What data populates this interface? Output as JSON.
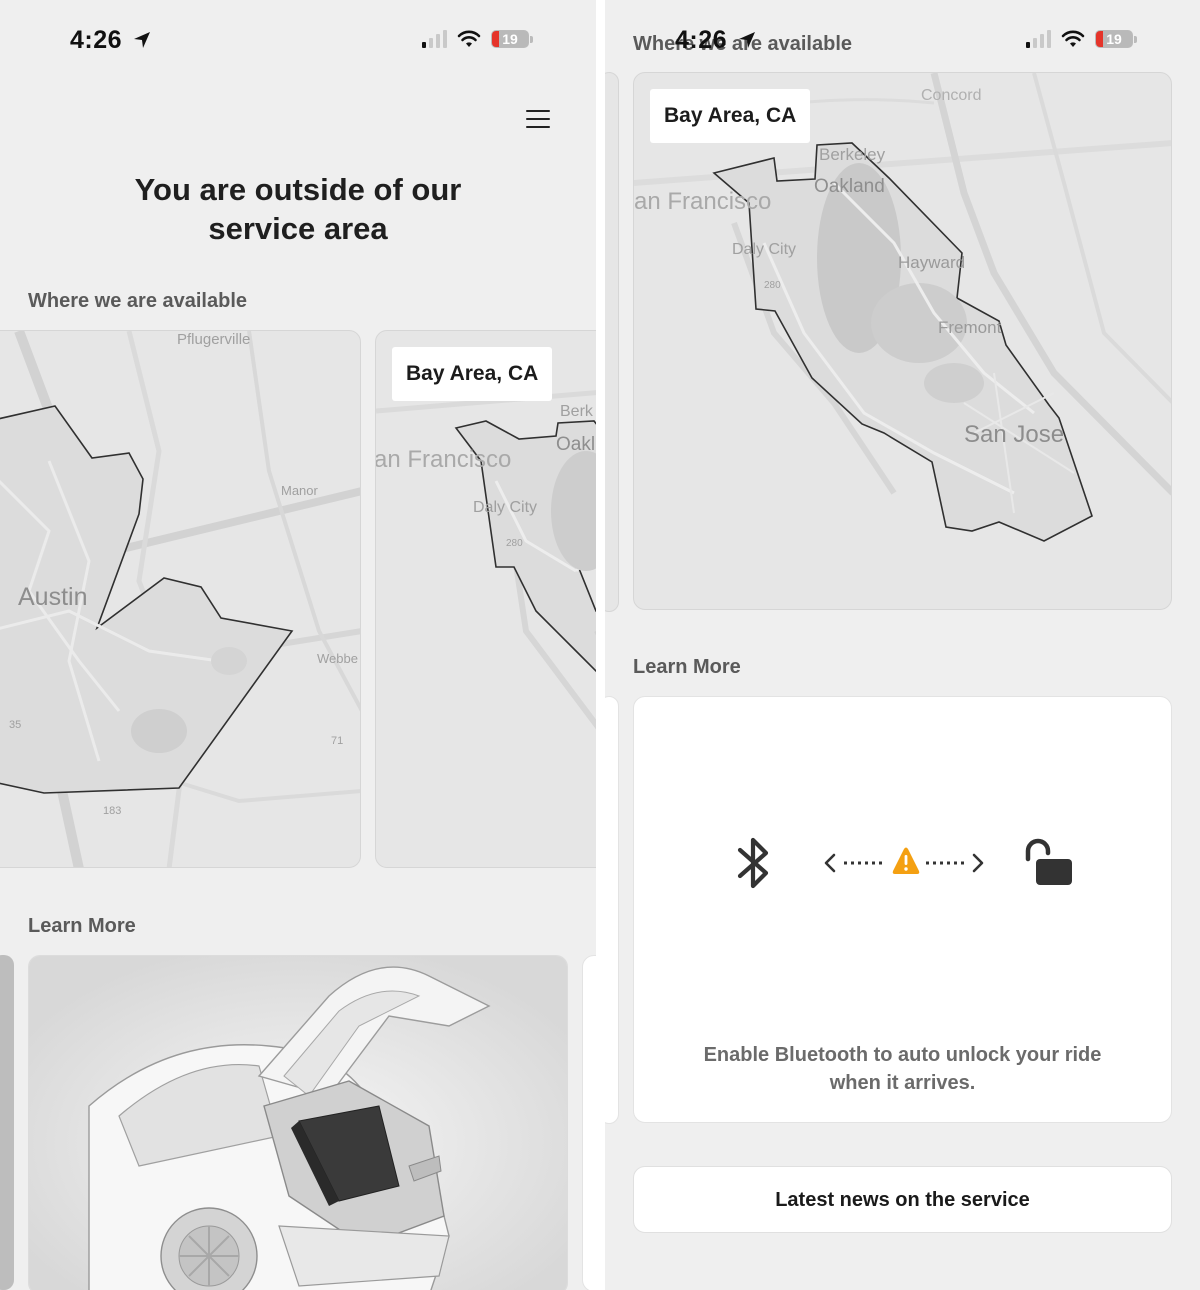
{
  "status_bar": {
    "time": "4:26",
    "battery": "19",
    "location_icon": "location-arrow-icon",
    "signal_icon": "cellular-signal-icon",
    "wifi_icon": "wifi-icon"
  },
  "left_screen": {
    "menu_icon": "hamburger-menu-icon",
    "title_line1": "You are outside of our",
    "title_line2": "service area",
    "available_heading": "Where we are available",
    "maps": [
      {
        "region": "Austin",
        "places": [
          "Pflugerville",
          "Manor",
          "Webbe",
          "183",
          "71",
          "35"
        ]
      },
      {
        "label": "Bay Area, CA",
        "places": [
          "an Francisco",
          "Berk",
          "Oakl",
          "Daly City",
          "280"
        ]
      }
    ],
    "learn_more_heading": "Learn More"
  },
  "right_screen": {
    "available_heading": "Where we are available",
    "map": {
      "label": "Bay Area, CA",
      "places": [
        "Concord",
        "Berkeley",
        "Oakland",
        "an Francisco",
        "Daly City",
        "Hayward",
        "Fremont",
        "San Jose",
        "280"
      ]
    },
    "learn_more_heading": "Learn More",
    "bluetooth_card": {
      "text_line1": "Enable Bluetooth to auto unlock your ride",
      "text_line2": "when it arrives.",
      "icons": [
        "bluetooth-icon",
        "warning-icon",
        "unlock-icon"
      ]
    },
    "news_button": "Latest news on the service"
  },
  "colors": {
    "background": "#efefef",
    "card": "#ffffff",
    "warning": "#f4a012",
    "battery_low": "#e5342a"
  }
}
